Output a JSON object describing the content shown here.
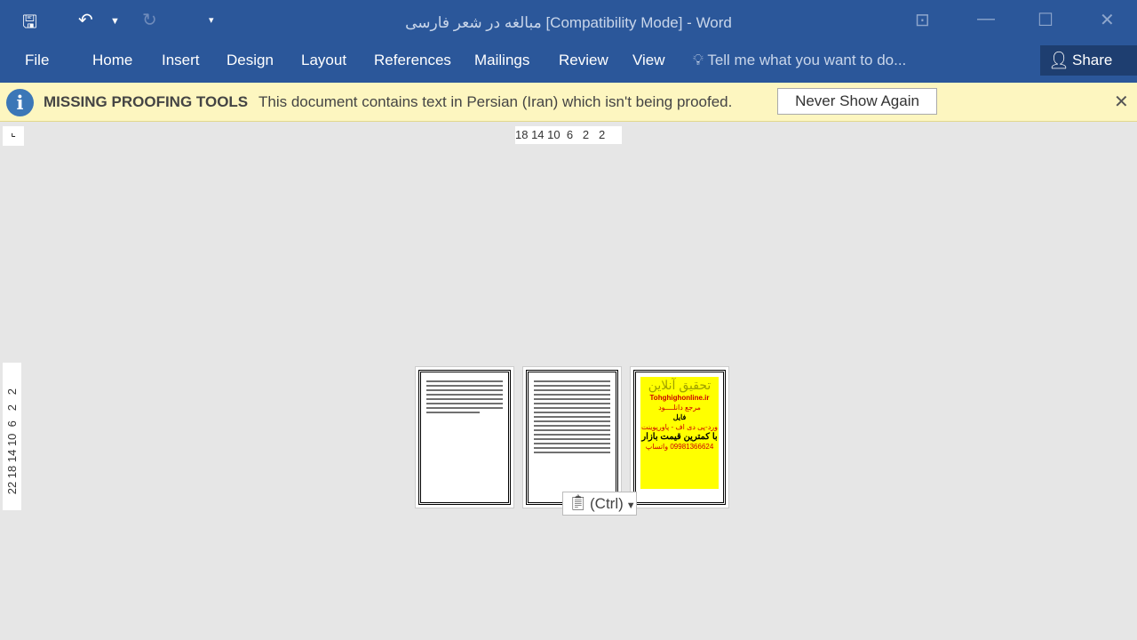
{
  "titlebar": {
    "title": "مبالغه در شعر فارسی [Compatibility Mode] - Word",
    "save_icon": "save-icon",
    "undo_icon": "undo-icon",
    "redo_icon": "redo-icon"
  },
  "ribbon": {
    "tabs": [
      "File",
      "Home",
      "Insert",
      "Design",
      "Layout",
      "References",
      "Mailings",
      "Review",
      "View"
    ],
    "tell_me": "Tell me what you want to do...",
    "share": "Share"
  },
  "message_bar": {
    "title": "MISSING PROOFING TOOLS",
    "text": "This document contains text in Persian (Iran) which isn't being proofed.",
    "button": "Never Show Again"
  },
  "rulers": {
    "horizontal": "18 14 10  6   2   2",
    "vertical": "22 18 14 10  6   2   2"
  },
  "ad": {
    "title": "تحقیق آنلاین",
    "site": "Tohghighonline.ir",
    "line1": "مرجع دانلــــود",
    "line2": "فایل",
    "line3": "ورد-پی دی اف - پاورپوینت",
    "line4": "با کمترین قیمت بازار",
    "line5": "09981366624 واتساپ"
  },
  "paste_options": {
    "label": "(Ctrl)"
  },
  "colors": {
    "accent": "#2b579a",
    "message_bar": "#fdf6c0"
  }
}
